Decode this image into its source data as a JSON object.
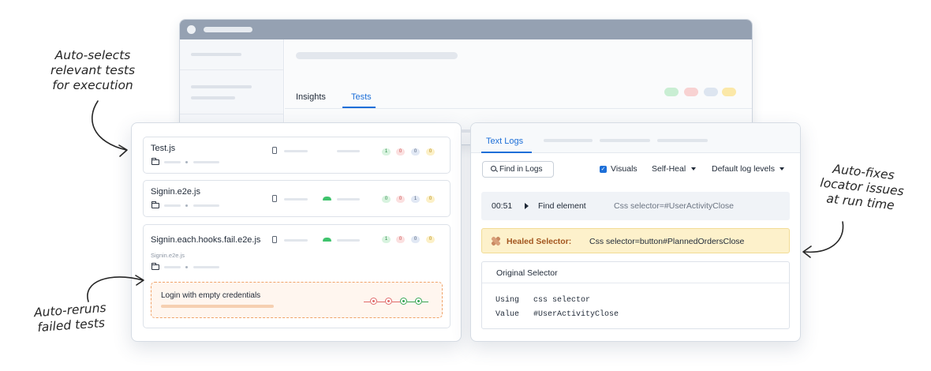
{
  "annotations": {
    "auto_selects": [
      "Auto-selects",
      "relevant tests",
      "for execution"
    ],
    "auto_reruns": [
      "Auto-reruns",
      "failed tests"
    ],
    "auto_fixes": [
      "Auto-fixes",
      "locator issues",
      "at run time"
    ]
  },
  "background_window": {
    "tabs": [
      "Insights",
      "Tests"
    ],
    "active_tab": "Tests",
    "chip_colors": [
      "#c9eed3",
      "#f8d2d2",
      "#dde5f0",
      "#fbe8a8"
    ]
  },
  "tests": [
    {
      "name": "Test.js",
      "platform": "apple-icon",
      "counts": [
        "1",
        "0",
        "0",
        "0"
      ]
    },
    {
      "name": "Signin.e2e.js",
      "platform": "android-icon",
      "counts": [
        "0",
        "0",
        "1",
        "0"
      ]
    },
    {
      "name": "Signin.each.hooks.fail.e2e.js",
      "subtitle": "Signin.e2e.js",
      "platform": "android-icon",
      "counts": [
        "1",
        "0",
        "0",
        "0"
      ]
    }
  ],
  "rerun": {
    "label": "Login with empty credentials",
    "attempts": [
      "failed",
      "failed",
      "passed",
      "passed"
    ]
  },
  "logs_panel": {
    "tab": "Text Logs",
    "find_button": "Find in Logs",
    "visuals_label": "Visuals",
    "visuals_checked": true,
    "self_heal_label": "Self-Heal",
    "log_levels_label": "Default log levels",
    "log_entry": {
      "time": "00:51",
      "action": "Find element",
      "detail": "Css selector=#UserActivityClose"
    },
    "healed": {
      "label": "Healed Selector:",
      "value": "Css selector=button#PlannedOrdersClose"
    },
    "original": {
      "title": "Original Selector",
      "using_key": "Using",
      "using_value": "css selector",
      "value_key": "Value",
      "value_value": "#UserActivityClose"
    }
  },
  "colors": {
    "accent": "#1d6fd8",
    "heal_bg": "#fdf1cb",
    "heal_text": "#a3561f",
    "rerun_border": "#f0a369"
  }
}
